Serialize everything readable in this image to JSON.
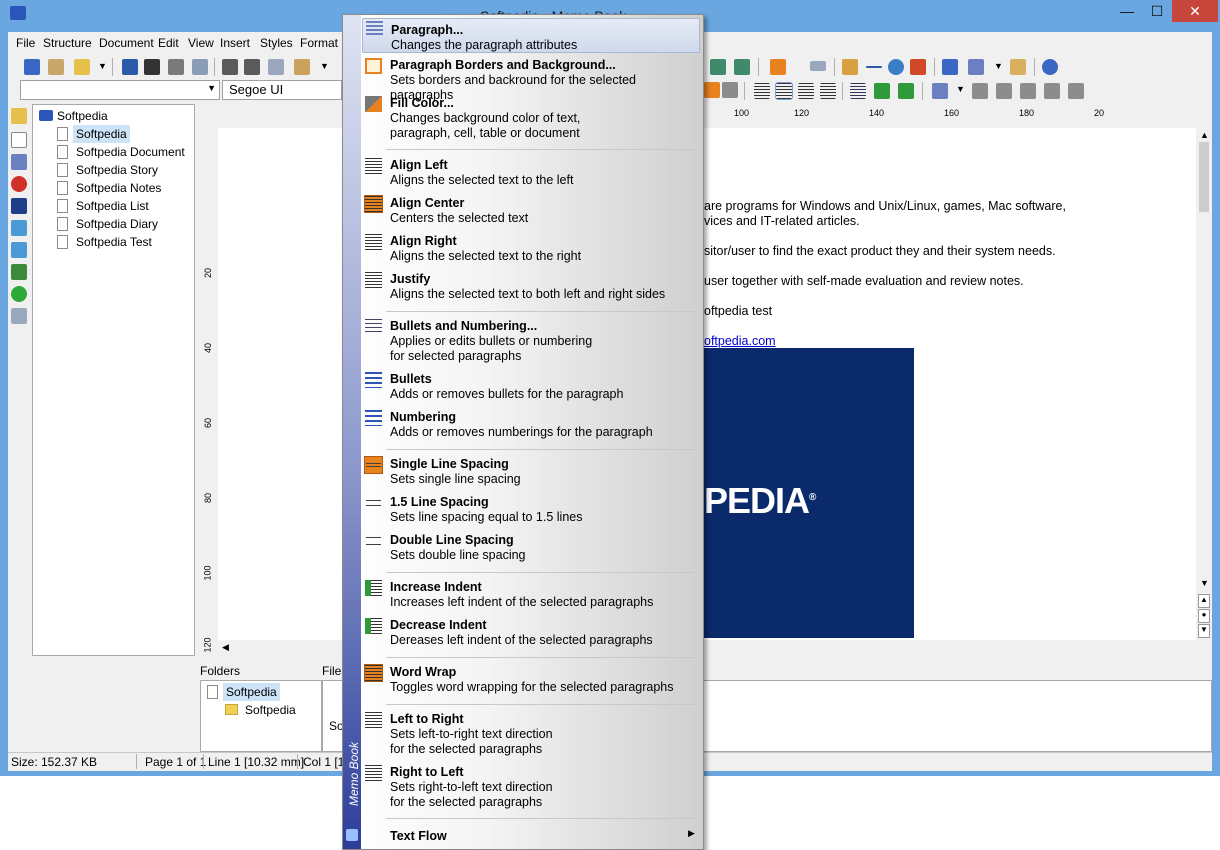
{
  "window": {
    "title": "Softpedia - Memo Book",
    "controls": [
      "minimize",
      "maximize",
      "close"
    ]
  },
  "menubar": [
    {
      "label": "File",
      "underline": "F"
    },
    {
      "label": "Structure"
    },
    {
      "label": "Document"
    },
    {
      "label": "Edit",
      "underline": "E"
    },
    {
      "label": "View",
      "underline": "V"
    },
    {
      "label": "Insert",
      "underline": "I"
    },
    {
      "label": "Styles"
    },
    {
      "label": "Format",
      "underline": "o"
    }
  ],
  "font": {
    "name": "Segoe UI"
  },
  "ruler": {
    "h_ticks": [
      "100",
      "120",
      "140",
      "160",
      "180",
      "20"
    ],
    "v_ticks": [
      "20",
      "40",
      "60",
      "80",
      "100",
      "120"
    ]
  },
  "tree": {
    "root": "Softpedia",
    "items": [
      "Softpedia",
      "Softpedia Document",
      "Softpedia Story",
      "Softpedia Notes",
      "Softpedia List",
      "Softpedia Diary",
      "Softpedia Test"
    ]
  },
  "document": {
    "lines": [
      "are programs for Windows and Unix/Linux, games, Mac software,",
      "vices and IT-related articles.",
      "sitor/user to find the exact product they and their system needs.",
      "user together with self-made evaluation and review notes.",
      "oftpedia test"
    ],
    "link": "oftpedia.com",
    "logo": "PEDIA",
    "logo_mark": "®"
  },
  "panes": {
    "folders_label": "Folders",
    "files_label": "Files",
    "folder_root": "Softpedia",
    "folder_child": "Softpedia",
    "file_fragment": "So"
  },
  "status": {
    "size": "Size: 152.37 KB",
    "page": "Page 1 of 1",
    "line": "Line 1 [10.32 mm]",
    "col": "Col 1 [1"
  },
  "context_menu": {
    "band_label": "Memo Book",
    "items": [
      {
        "title": "Paragraph...",
        "desc": "Changes the paragraph attributes",
        "icon": "paragraph-icon"
      },
      {
        "title": "Paragraph Borders and Background...",
        "desc": "Sets borders and backround for the selected paragraphs",
        "icon": "borders-icon"
      },
      {
        "title": "Fill Color...",
        "desc": "Changes background color of  text,\nparagraph, cell, table or document",
        "icon": "fill-color-icon"
      },
      {
        "title": "Align Left",
        "desc": "Aligns the selected text to the left",
        "icon": "align-left-icon"
      },
      {
        "title": "Align Center",
        "desc": "Centers the selected text",
        "icon": "align-center-icon"
      },
      {
        "title": "Align Right",
        "desc": "Aligns the selected text to the right",
        "icon": "align-right-icon"
      },
      {
        "title": "Justify",
        "desc": "Aligns the selected text to both left and right sides",
        "icon": "justify-icon"
      },
      {
        "title": "Bullets and Numbering...",
        "desc": "Applies or edits bullets or numbering\nfor selected paragraphs",
        "icon": "bullets-numbering-icon"
      },
      {
        "title": "Bullets",
        "desc": "Adds or removes bullets for the paragraph",
        "icon": "bullets-icon"
      },
      {
        "title": "Numbering",
        "desc": "Adds or removes numberings for the paragraph",
        "icon": "numbering-icon"
      },
      {
        "title": "Single Line Spacing",
        "desc": "Sets single line spacing",
        "icon": "single-spacing-icon"
      },
      {
        "title": "1.5 Line Spacing",
        "desc": "Sets line spacing equal to 1.5 lines",
        "icon": "one-half-spacing-icon"
      },
      {
        "title": "Double Line Spacing",
        "desc": "Sets double line spacing",
        "icon": "double-spacing-icon"
      },
      {
        "title": "Increase Indent",
        "desc": "Increases left indent of the selected paragraphs",
        "icon": "increase-indent-icon"
      },
      {
        "title": "Decrease Indent",
        "desc": "Dereases left indent of the selected paragraphs",
        "icon": "decrease-indent-icon"
      },
      {
        "title": "Word Wrap",
        "desc": "Toggles word wrapping for the selected paragraphs",
        "icon": "word-wrap-icon"
      },
      {
        "title": "Left to Right",
        "desc": "Sets left-to-right text direction\nfor the selected paragraphs",
        "icon": "ltr-icon"
      },
      {
        "title": "Right to Left",
        "desc": "Sets right-to-left text direction\nfor the selected paragraphs",
        "icon": "rtl-icon"
      },
      {
        "title": "Text Flow",
        "desc": "",
        "icon": "text-flow-icon"
      }
    ]
  },
  "colors": {
    "frame": "#6aa6e0",
    "logo_bg": "#0a2a6c",
    "accent_orange": "#e8821e",
    "link": "#0000cc"
  }
}
